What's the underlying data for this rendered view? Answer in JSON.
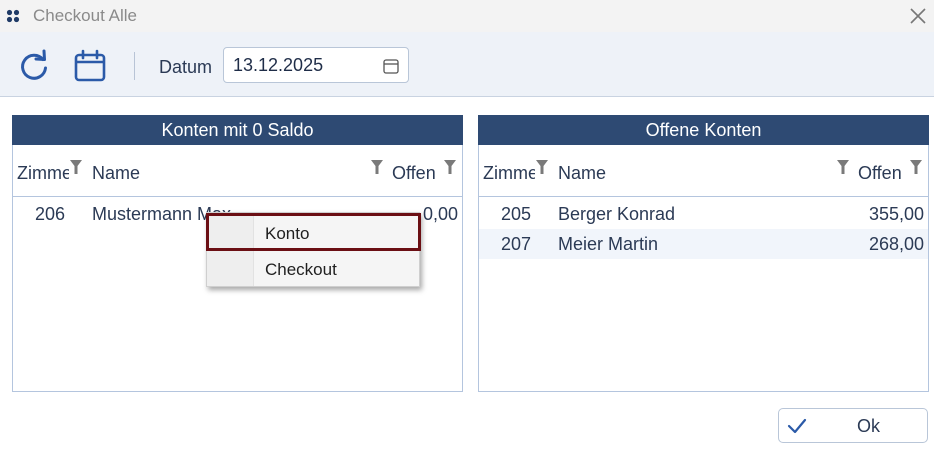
{
  "window": {
    "title": "Checkout Alle"
  },
  "toolbar": {
    "datum_label": "Datum",
    "date_value": "13.12.2025"
  },
  "left_panel": {
    "title": "Konten mit 0 Saldo",
    "columns": {
      "zimmer": "Zimmer",
      "name": "Name",
      "offen": "Offen"
    },
    "rows": [
      {
        "zimmer": "206",
        "name": "Mustermann Max",
        "offen": "0,00"
      }
    ]
  },
  "right_panel": {
    "title": "Offene Konten",
    "columns": {
      "zimmer": "Zimmer",
      "name": "Name",
      "offen": "Offen"
    },
    "rows": [
      {
        "zimmer": "205",
        "name": "Berger Konrad",
        "offen": "355,00"
      },
      {
        "zimmer": "207",
        "name": "Meier Martin",
        "offen": "268,00"
      }
    ]
  },
  "context_menu": {
    "items": [
      "Konto",
      "Checkout"
    ]
  },
  "footer": {
    "ok_label": "Ok"
  },
  "colors": {
    "header_bg": "#2e4a73",
    "highlight_border": "#6b0f14",
    "accent": "#2b5aa8"
  }
}
